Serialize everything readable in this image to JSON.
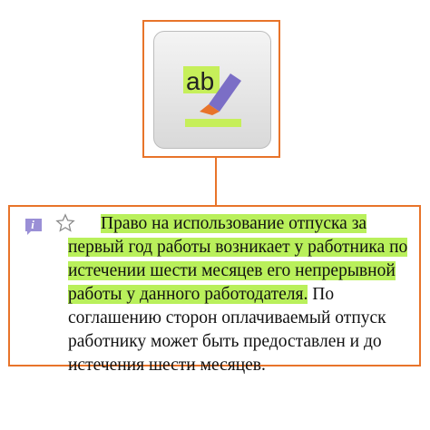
{
  "icon": {
    "name": "highlighter-icon",
    "glyph_text": "ab",
    "colors": {
      "highlight": "#c6ef5a",
      "pen": "#7b6ec6",
      "pen_tip": "#e8742a",
      "frame_border": "#e8742a"
    }
  },
  "card": {
    "info_icon": "info-icon",
    "star_icon": "star-icon",
    "highlighted_text": "Право на использование отпуска за первый год работы возникает у работника по истечении шести месяцев его непрерывной работы у данного работодателя.",
    "plain_text": " По соглашению сторон оплачиваемый отпуск работнику может быть предоставлен и до истечения шести месяцев.",
    "highlight_color": "#b9f05b"
  }
}
